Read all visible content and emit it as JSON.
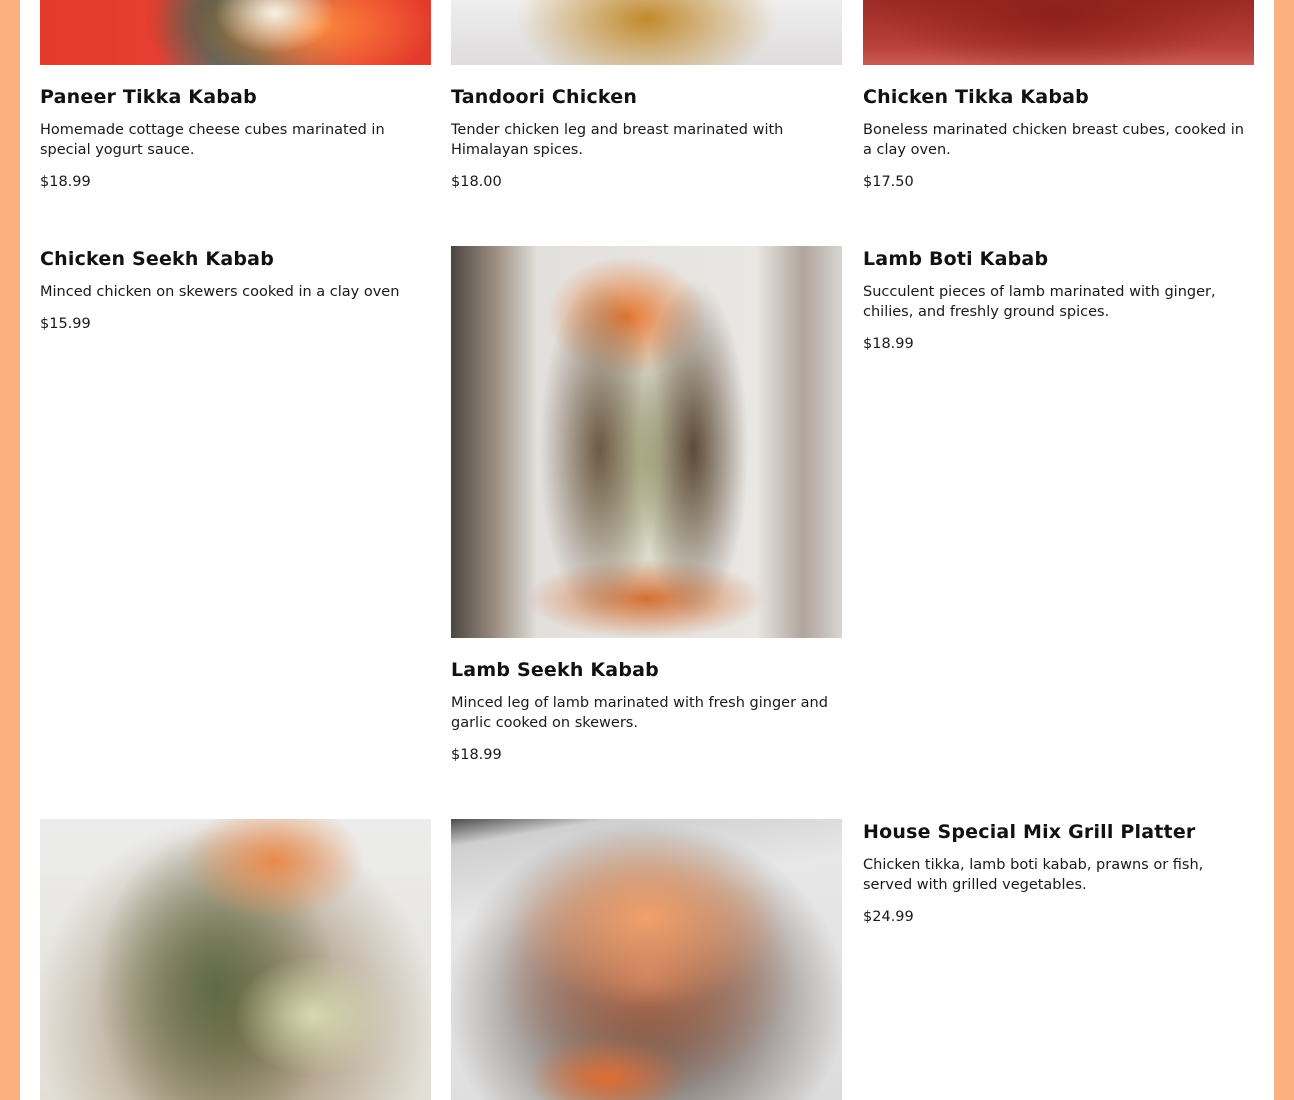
{
  "menu": {
    "items": [
      {
        "name": "Paneer Tikka Kabab",
        "description": "Homemade cottage cheese cubes marinated in special yogurt sauce.",
        "price": "$18.99"
      },
      {
        "name": "Tandoori Chicken",
        "description": "Tender chicken leg and breast marinated with Himalayan spices.",
        "price": "$18.00"
      },
      {
        "name": "Chicken Tikka Kabab",
        "description": "Boneless marinated chicken breast cubes, cooked in a clay oven.",
        "price": "$17.50"
      },
      {
        "name": "Chicken Seekh Kabab",
        "description": "Minced chicken on skewers cooked in a clay oven",
        "price": "$15.99"
      },
      {
        "name": "Lamb Seekh Kabab",
        "description": "Minced leg of lamb marinated with fresh ginger and garlic cooked on skewers.",
        "price": "$18.99"
      },
      {
        "name": "Lamb Boti Kabab",
        "description": "Succulent pieces of lamb marinated with ginger, chilies, and freshly ground spices.",
        "price": "$18.99"
      },
      {
        "name": "House Special Mix Grill Platter",
        "description": "Chicken tikka, lamb boti kabab, prawns or fish, served with grilled vegetables.",
        "price": "$24.99"
      }
    ]
  },
  "colors": {
    "page_border": "#fdb07e",
    "background": "#ffffff",
    "text": "#111111"
  }
}
